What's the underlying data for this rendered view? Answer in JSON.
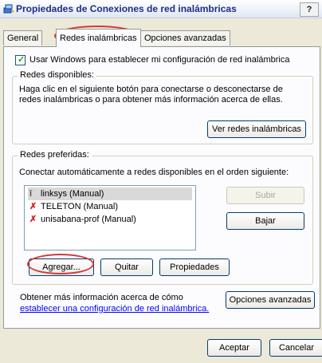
{
  "window": {
    "title": "Propiedades de Conexiones de red inalámbricas",
    "help": "?"
  },
  "tabs": [
    {
      "label": "General"
    },
    {
      "label": "Redes inalámbricas"
    },
    {
      "label": "Opciones avanzadas"
    }
  ],
  "use_windows": {
    "label": "Usar Windows para establecer mi configuración de red inalámbrica",
    "checked": true
  },
  "available": {
    "legend": "Redes disponibles:",
    "description": "Haga clic en el siguiente botón para conectarse o desconectarse de redes inalámbricas o para obtener más información acerca de ellas.",
    "button": "Ver redes inalámbricas"
  },
  "preferred": {
    "legend": "Redes preferidas:",
    "description": "Conectar automáticamente a redes disponibles en el orden siguiente:",
    "networks": [
      {
        "label": "linksys (Manual)",
        "icon": "antenna-icon",
        "selected": true
      },
      {
        "label": "TELETON (Manual)",
        "icon": "antenna-x-icon",
        "selected": false
      },
      {
        "label": "unisabana-prof (Manual)",
        "icon": "antenna-x-icon",
        "selected": false
      }
    ],
    "up": "Subir",
    "down": "Bajar",
    "add": "Agregar...",
    "remove": "Quitar",
    "properties": "Propiedades"
  },
  "more_info": {
    "text": "Obtener más información acerca de cómo",
    "link": "establecer una configuración de red inalámbrica.",
    "advanced": "Opciones avanzadas"
  },
  "footer": {
    "ok": "Aceptar",
    "cancel": "Cancelar"
  }
}
